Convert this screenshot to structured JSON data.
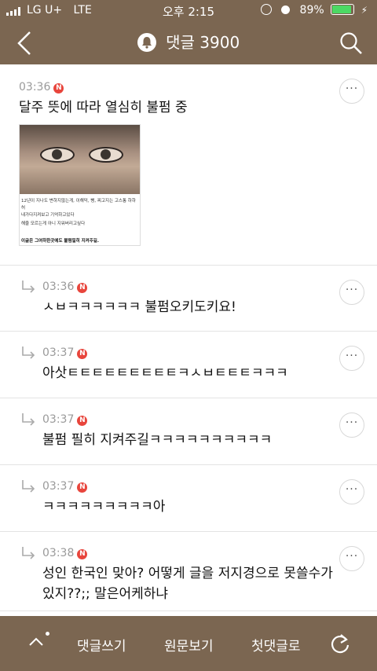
{
  "status_bar": {
    "carrier": "LG U+",
    "network": "LTE",
    "time": "오후 2:15",
    "battery": "89%"
  },
  "header": {
    "title": "댓글 3900"
  },
  "comments": [
    {
      "time": "03:36",
      "badge": "N",
      "text": "달주 뜻에 따라 열심히 불펌 중",
      "more": "···",
      "attachment": {
        "caption_line1": "12년이 지나도 변하지않는게, 이해덕, 뻥, 찌고지는 고스통 하하허",
        "caption_line2": "내가다지켜보고 기억하고있다",
        "caption_line3": "해줄 모르는게 아니 지워버리고싶다",
        "caption_line4": "이글은 그여하한곳에도 불펌필히 지켜주길."
      }
    },
    {
      "time": "03:36",
      "badge": "N",
      "text": "ㅅㅂㅋㅋㅋㅋㅋㅋ 불펌오키도키요!",
      "more": "···"
    },
    {
      "time": "03:37",
      "badge": "N",
      "text": "아삿ㅌㅌㅌㅌㅌㅌㅌㅌㅌㅋㅅㅂㅌㅌㅌㅋㅋㅋ",
      "more": "···"
    },
    {
      "time": "03:37",
      "badge": "N",
      "text": "불펌 필히 지켜주길ㅋㅋㅋㅋㅋㅋㅋㅋㅋㅋ",
      "more": "···"
    },
    {
      "time": "03:37",
      "badge": "N",
      "text": "ㅋㅋㅋㅋㅋㅋㅋㅋㅋ아",
      "more": "···"
    },
    {
      "time": "03:38",
      "badge": "N",
      "text": "성인 한국인 맞아? 어떻게 글을 저지경으로 못쓸수가있지??;; 말은어케하냐",
      "more": "···"
    }
  ],
  "bottom_bar": {
    "write": "댓글쓰기",
    "view_original": "원문보기",
    "first_comment": "첫댓글로"
  },
  "colors": {
    "bar": "#7b6651",
    "badge": "#e8453c",
    "battery": "#4cd964"
  }
}
